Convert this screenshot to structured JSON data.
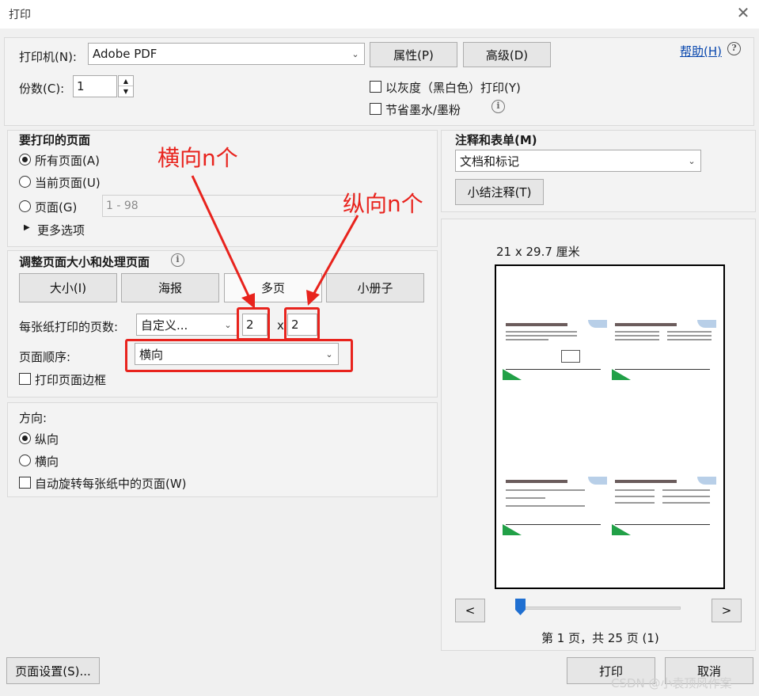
{
  "window": {
    "title": "打印"
  },
  "printer": {
    "label": "打印机(N):",
    "selected": "Adobe PDF",
    "properties_label": "属性(P)",
    "advanced_label": "高级(D)",
    "help_label": "帮助(H)",
    "copies_label": "份数(C):",
    "copies_value": "1",
    "grayscale_label": "以灰度（黑白色）打印(Y)",
    "grayscale_checked": false,
    "save_ink_label": "节省墨水/墨粉",
    "save_ink_checked": false
  },
  "pages_to_print": {
    "heading": "要打印的页面",
    "all_label": "所有页面(A)",
    "current_label": "当前页面(U)",
    "pages_label": "页面(G)",
    "range_placeholder": "1 - 98",
    "more_options_label": "更多选项",
    "selected": "all"
  },
  "page_sizing": {
    "heading": "调整页面大小和处理页面",
    "buttons": [
      "大小(I)",
      "海报",
      "多页",
      "小册子"
    ],
    "active": "多页",
    "pages_per_sheet_label": "每张纸打印的页数:",
    "pages_per_sheet_value": "自定义...",
    "cols": "2",
    "times": "x",
    "rows": "2",
    "page_order_label": "页面顺序:",
    "page_order_value": "横向",
    "print_border_label": "打印页面边框",
    "print_border_checked": false
  },
  "orientation": {
    "heading": "方向:",
    "portrait_label": "纵向",
    "landscape_label": "横向",
    "auto_rotate_label": "自动旋转每张纸中的页面(W)",
    "selected": "portrait",
    "auto_rotate_checked": false
  },
  "comments": {
    "heading": "注释和表单(M)",
    "selected": "文档和标记",
    "summarize_label": "小结注释(T)"
  },
  "preview": {
    "size_label": "21 x 29.7 厘米",
    "prev_label": "<",
    "next_label": ">",
    "page_status": "第 1 页，共 25 页 (1)",
    "slider_position": 0.0
  },
  "footer": {
    "page_setup_label": "页面设置(S)...",
    "print_label": "打印",
    "cancel_label": "取消"
  },
  "annotations": {
    "horizontal_n": "横向n个",
    "vertical_n": "纵向n个"
  },
  "watermark": "CSDN @小袁顶风作案",
  "colors": {
    "annotation_red": "#e8231d",
    "link_blue": "#0645ad",
    "slider_blue": "#1f6fd1"
  }
}
